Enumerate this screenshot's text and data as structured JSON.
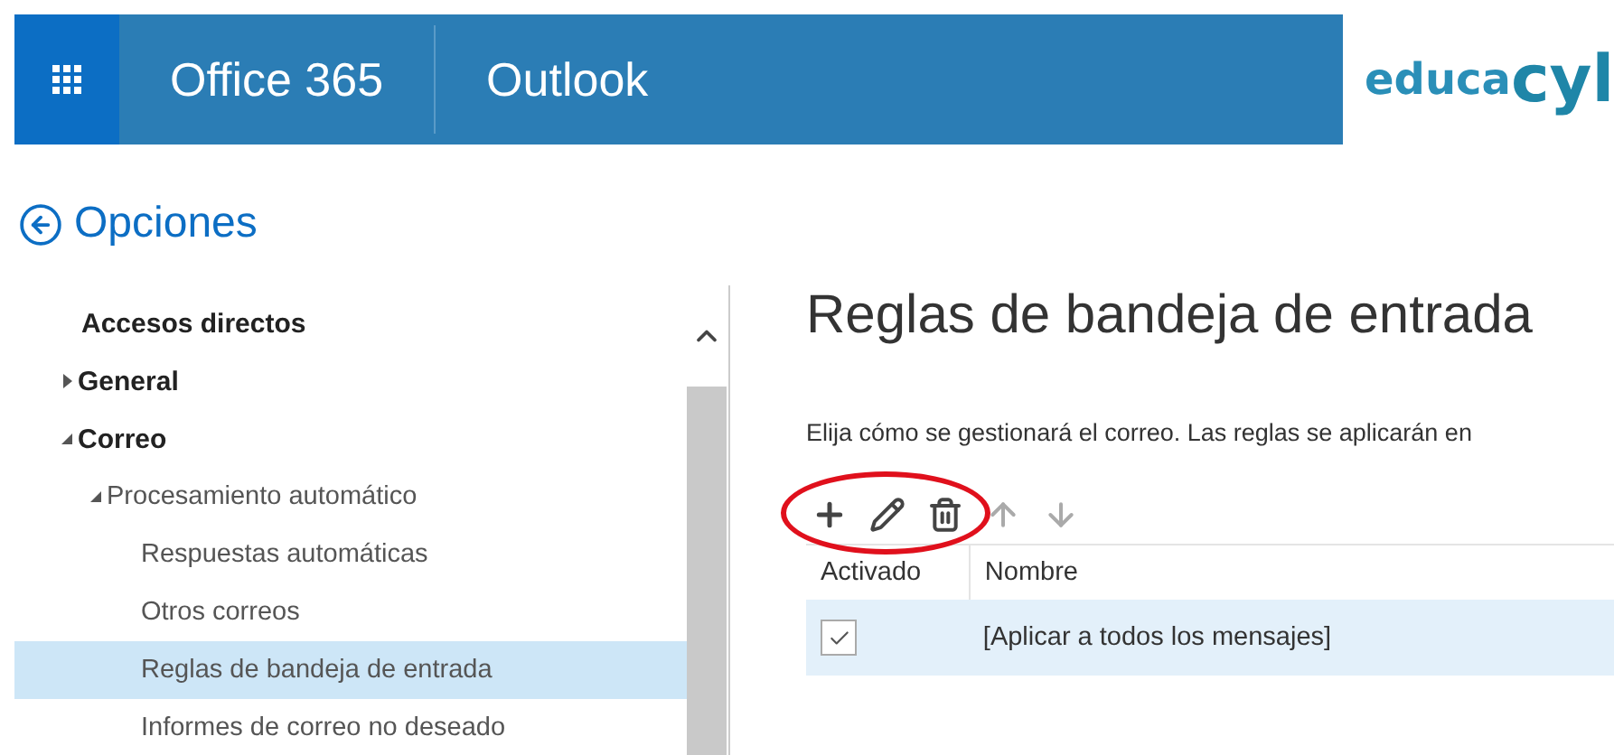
{
  "header": {
    "brand": "Office 365",
    "app": "Outlook",
    "logo": {
      "part_1": "educa",
      "part_2": "cyl"
    }
  },
  "page_title": "Opciones",
  "sidebar": {
    "items": [
      {
        "kind": "heading",
        "label": "Accesos directos",
        "selected": false
      },
      {
        "kind": "group",
        "label": "General",
        "expanded": false,
        "selected": false
      },
      {
        "kind": "group",
        "label": "Correo",
        "expanded": true,
        "selected": false,
        "children": [
          {
            "kind": "group",
            "label": "Procesamiento automático",
            "expanded": true,
            "selected": false,
            "children": [
              {
                "kind": "link",
                "label": "Respuestas automáticas",
                "selected": false
              },
              {
                "kind": "link",
                "label": "Otros correos",
                "selected": false
              },
              {
                "kind": "link",
                "label": "Reglas de bandeja de entrada",
                "selected": true
              },
              {
                "kind": "link",
                "label": "Informes de correo no deseado",
                "selected": false
              }
            ]
          }
        ]
      }
    ]
  },
  "main": {
    "title": "Reglas de bandeja de entrada",
    "description": "Elija cómo se gestionará el correo. Las reglas se aplicarán en",
    "toolbar": [
      {
        "kind": "add",
        "disabled": false
      },
      {
        "kind": "edit",
        "disabled": false
      },
      {
        "kind": "delete",
        "disabled": false
      },
      {
        "kind": "up",
        "disabled": true
      },
      {
        "kind": "down",
        "disabled": true
      }
    ],
    "annotation": {
      "kind": "ellipse"
    },
    "table": {
      "columns": [
        "Activado",
        "Nombre"
      ],
      "rows": [
        {
          "checked": true,
          "name": "[Aplicar a todos los mensajes]",
          "selected": true
        }
      ]
    }
  }
}
